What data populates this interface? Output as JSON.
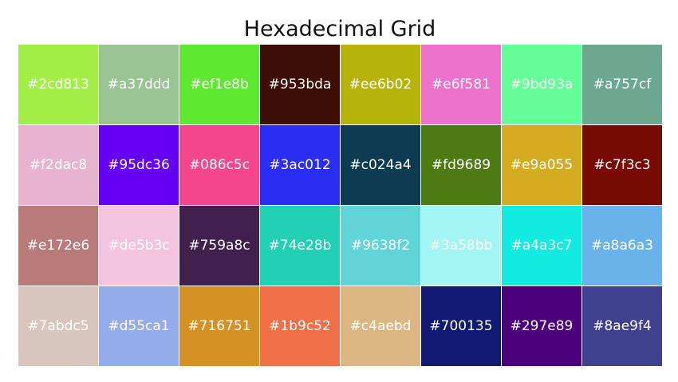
{
  "title": "Hexadecimal Grid",
  "cells": [
    {
      "label": "#2cd813",
      "color": "#a3ef47"
    },
    {
      "label": "#a37ddd",
      "color": "#9ac394"
    },
    {
      "label": "#ef1e8b",
      "color": "#5fe830"
    },
    {
      "label": "#953bda",
      "color": "#3c0e04"
    },
    {
      "label": "#ee6b02",
      "color": "#b6b40a"
    },
    {
      "label": "#e6f581",
      "color": "#ed72cd"
    },
    {
      "label": "#9bd93a",
      "color": "#66fe98"
    },
    {
      "label": "#a757cf",
      "color": "#6ba88f"
    },
    {
      "label": "#f2dac8",
      "color": "#e8b2d1"
    },
    {
      "label": "#95dc36",
      "color": "#6600f4"
    },
    {
      "label": "#086c5c",
      "color": "#f4468d"
    },
    {
      "label": "#3ac012",
      "color": "#2a2ef2"
    },
    {
      "label": "#c024a4",
      "color": "#0c3b52"
    },
    {
      "label": "#fd9689",
      "color": "#4d7a13"
    },
    {
      "label": "#e9a055",
      "color": "#d5ab21"
    },
    {
      "label": "#c7f3c3",
      "color": "#770b04"
    },
    {
      "label": "#e172e6",
      "color": "#b97a7a"
    },
    {
      "label": "#de5b3c",
      "color": "#f3c4de"
    },
    {
      "label": "#759a8c",
      "color": "#42204e"
    },
    {
      "label": "#74e28b",
      "color": "#22d0b6"
    },
    {
      "label": "#9638f2",
      "color": "#60d4d6"
    },
    {
      "label": "#3a58bb",
      "color": "#a2f5f2"
    },
    {
      "label": "#a4a3c7",
      "color": "#12ece0"
    },
    {
      "label": "#a8a6a3",
      "color": "#6ab2ea"
    },
    {
      "label": "#7abdc5",
      "color": "#d8c5be"
    },
    {
      "label": "#d55ca1",
      "color": "#95acea"
    },
    {
      "label": "#716751",
      "color": "#d69125"
    },
    {
      "label": "#1b9c52",
      "color": "#ee6f48"
    },
    {
      "label": "#c4aebd",
      "color": "#dcb682"
    },
    {
      "label": "#700135",
      "color": "#111a72"
    },
    {
      "label": "#297e89",
      "color": "#4b017c"
    },
    {
      "label": "#8ae9f4",
      "color": "#40418e"
    }
  ]
}
